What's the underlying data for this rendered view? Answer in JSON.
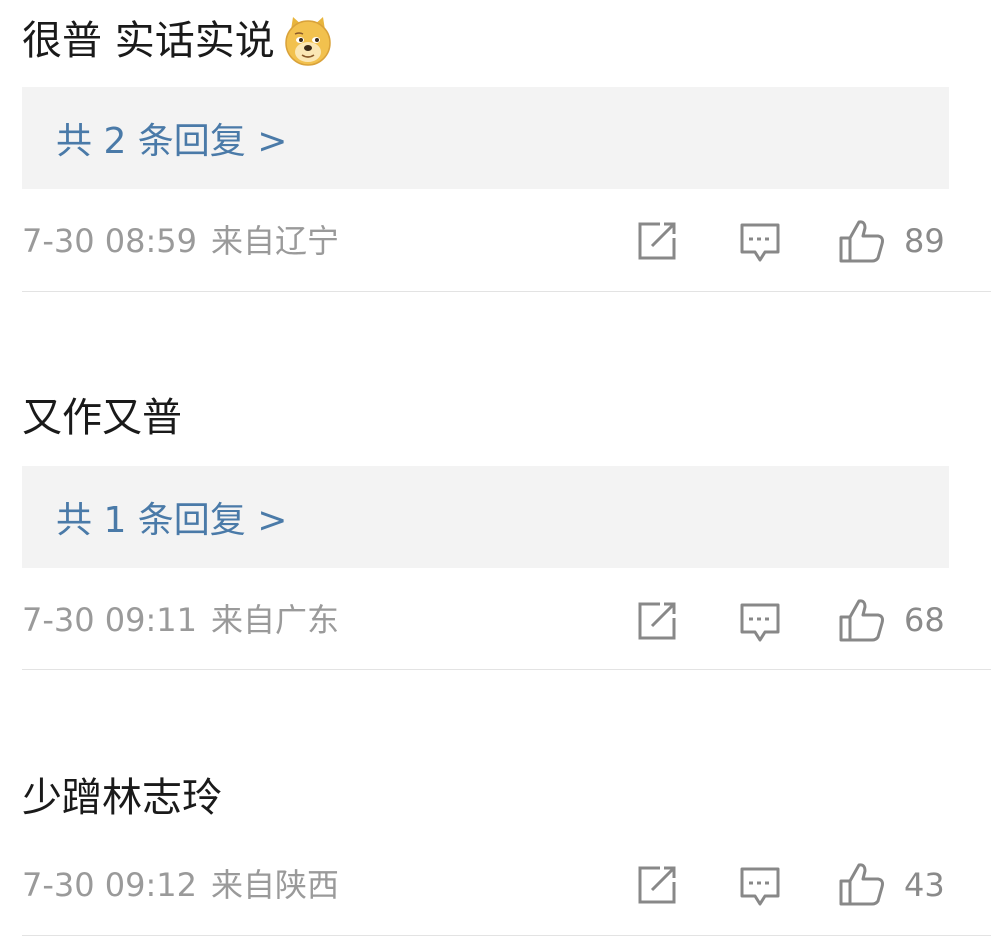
{
  "comments": [
    {
      "text": "很普 实话实说",
      "emoji": "doge-emoji",
      "replies_label": "共 2 条回复 >",
      "date": "7-30 08:59",
      "location": "来自辽宁",
      "likes": "89"
    },
    {
      "text": "又作又普",
      "replies_label": "共 1 条回复 >",
      "date": "7-30 09:11",
      "location": "来自广东",
      "likes": "68"
    },
    {
      "text": "少蹭林志玲",
      "date": "7-30 09:12",
      "location": "来自陕西",
      "likes": "43"
    }
  ],
  "icons": {
    "repost": "repost-icon",
    "comment": "comment-icon",
    "like": "thumbs-up-icon"
  },
  "colors": {
    "link": "#4a7aa8",
    "meta": "#9a9a9a",
    "reply_bg": "#f3f3f3"
  }
}
